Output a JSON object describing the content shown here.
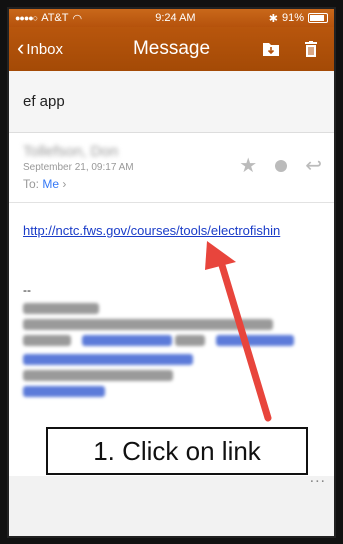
{
  "status": {
    "carrier": "AT&T",
    "time": "9:24 AM",
    "battery": "91%"
  },
  "nav": {
    "back_label": "Inbox",
    "title": "Message"
  },
  "message": {
    "subject": "ef app",
    "sender": "Tollefson, Don",
    "date": "September 21, 09:17 AM",
    "to_label": "To:",
    "to_value": "Me",
    "link": "http://nctc.fws.gov/courses/tools/electrofishin",
    "sig_dash": "--",
    "more": "..."
  },
  "annotation": {
    "callout": "1. Click on link",
    "arrow_color": "#e8453c"
  },
  "colors": {
    "nav_bg": "#b5520c",
    "link": "#1a3cc8",
    "accent": "#3478f6"
  }
}
